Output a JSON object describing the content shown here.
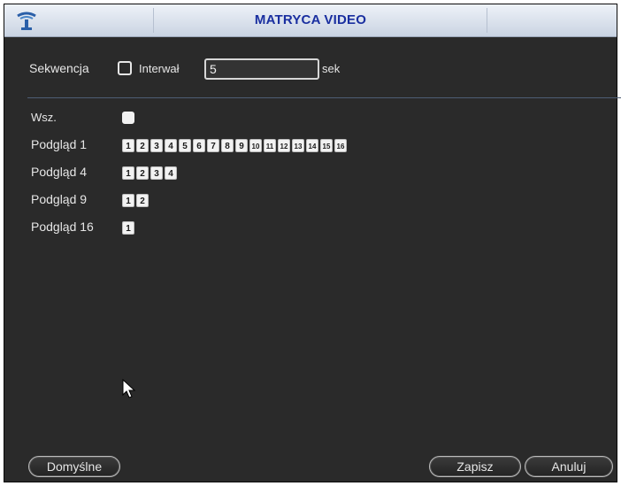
{
  "window": {
    "title": "MATRYCA VIDEO"
  },
  "sequence": {
    "label": "Sekwencja",
    "interval_label": "Interwał",
    "interval_value": "5",
    "unit": "sek"
  },
  "all_label": "Wsz.",
  "rows": [
    {
      "label": "Podgląd 1",
      "channels": [
        "1",
        "2",
        "3",
        "4",
        "5",
        "6",
        "7",
        "8",
        "9",
        "10",
        "11",
        "12",
        "13",
        "14",
        "15",
        "16"
      ]
    },
    {
      "label": "Podgląd 4",
      "channels": [
        "1",
        "2",
        "3",
        "4"
      ]
    },
    {
      "label": "Podgląd 9",
      "channels": [
        "1",
        "2"
      ]
    },
    {
      "label": "Podgląd 16",
      "channels": [
        "1"
      ]
    }
  ],
  "buttons": {
    "default": "Domyślne",
    "save": "Zapisz",
    "cancel": "Anuluj"
  },
  "icons": {
    "logo": "satellite-dish-icon",
    "cursor": "mouse-pointer-icon"
  }
}
